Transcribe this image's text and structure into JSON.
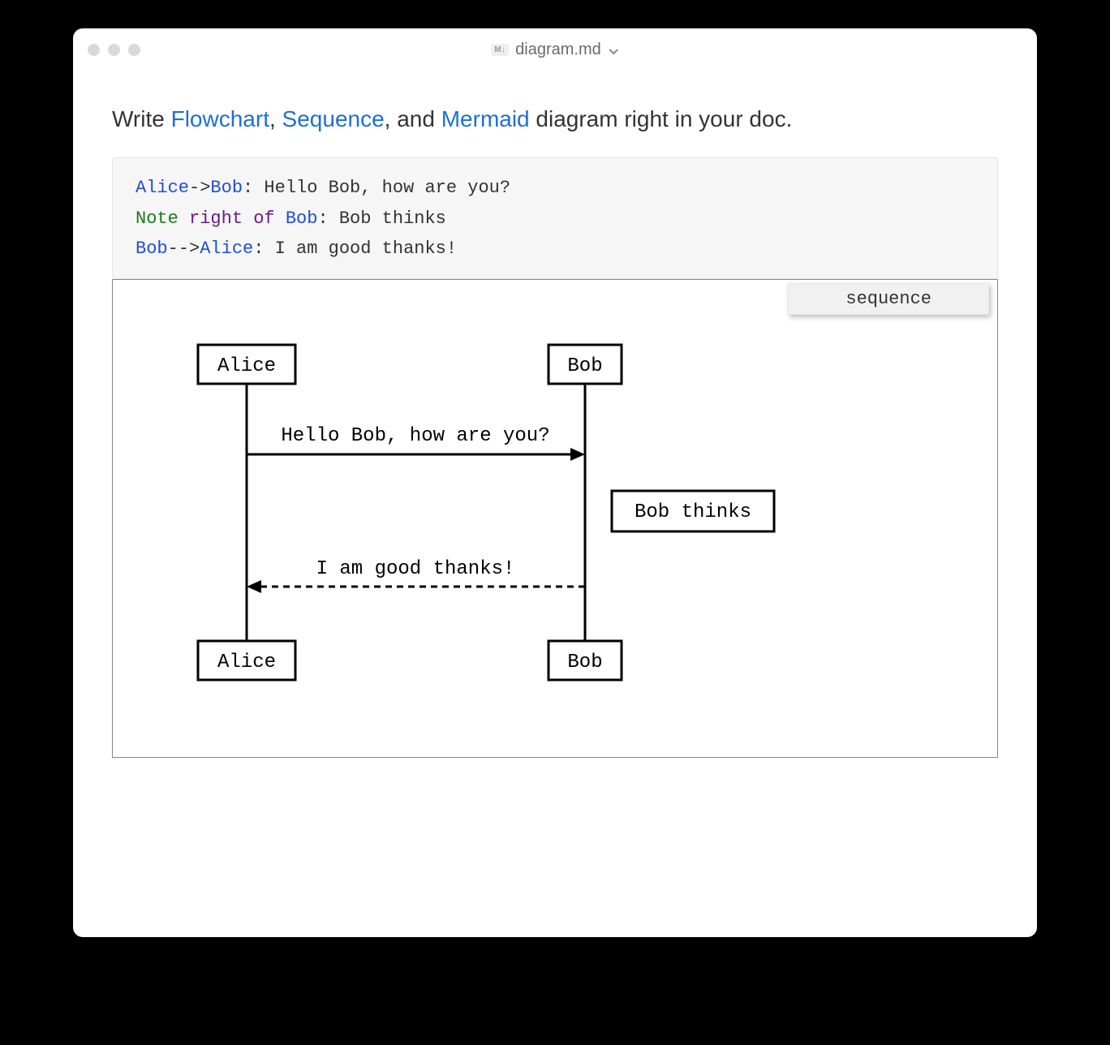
{
  "window": {
    "filename": "diagram.md",
    "file_badge": "M↓"
  },
  "intro": {
    "prefix": "Write ",
    "link_flowchart": "Flowchart",
    "sep1": ", ",
    "link_sequence": "Sequence",
    "sep2": ", and ",
    "link_mermaid": "Mermaid",
    "suffix": " diagram right in your doc."
  },
  "code": {
    "line1": {
      "a1": "Alice",
      "arr": "->",
      "a2": "Bob",
      "rest": ": Hello Bob, how are you?"
    },
    "line2": {
      "kw1": "Note",
      "kw2": "right of",
      "a1": "Bob",
      "rest": ": Bob thinks"
    },
    "line3": {
      "a1": "Bob",
      "arr": "-->",
      "a2": "Alice",
      "rest": ": I am good thanks!"
    }
  },
  "diagram": {
    "lang_label": "sequence",
    "actors": {
      "alice": "Alice",
      "bob": "Bob"
    },
    "msg1": "Hello Bob, how are you?",
    "note": "Bob thinks",
    "msg2": "I am good thanks!"
  },
  "chart_data": {
    "type": "sequence",
    "actors": [
      "Alice",
      "Bob"
    ],
    "events": [
      {
        "kind": "message",
        "from": "Alice",
        "to": "Bob",
        "style": "solid",
        "text": "Hello Bob, how are you?"
      },
      {
        "kind": "note",
        "position": "right of",
        "actor": "Bob",
        "text": "Bob thinks"
      },
      {
        "kind": "message",
        "from": "Bob",
        "to": "Alice",
        "style": "dashed",
        "text": "I am good thanks!"
      }
    ]
  }
}
